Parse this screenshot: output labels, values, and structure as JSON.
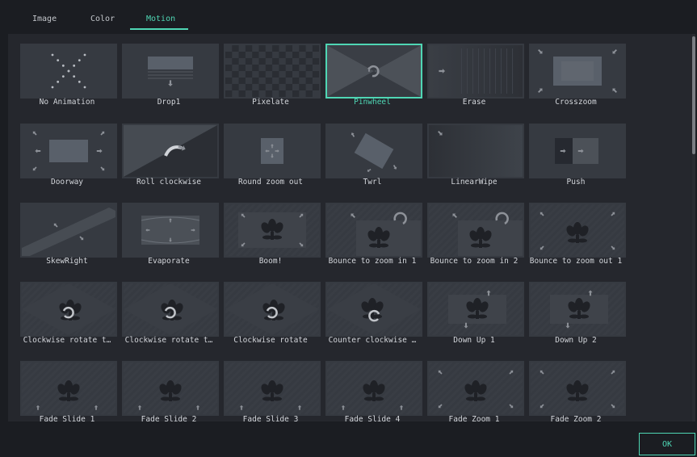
{
  "tabs": [
    {
      "label": "Image"
    },
    {
      "label": "Color"
    },
    {
      "label": "Motion"
    }
  ],
  "active_tab": "Motion",
  "selected_item": "Pinwheel",
  "ok_label": "OK",
  "accent_color": "#4fd6b4",
  "items": [
    {
      "label": "No Animation",
      "icon": "dots-x-icon"
    },
    {
      "label": "Drop1",
      "icon": "drop-icon"
    },
    {
      "label": "Pixelate",
      "icon": "checker-icon"
    },
    {
      "label": "Pinwheel",
      "icon": "pinwheel-icon"
    },
    {
      "label": "Erase",
      "icon": "erase-icon"
    },
    {
      "label": "Crosszoom",
      "icon": "crosszoom-icon"
    },
    {
      "label": "Doorway",
      "icon": "doorway-icon"
    },
    {
      "label": "Roll clockwise",
      "icon": "roll-icon"
    },
    {
      "label": "Round zoom out",
      "icon": "round-zoom-icon"
    },
    {
      "label": "Twrl",
      "icon": "twirl-icon"
    },
    {
      "label": "LinearWipe",
      "icon": "linear-wipe-icon"
    },
    {
      "label": "Push",
      "icon": "push-icon"
    },
    {
      "label": "SkewRight",
      "icon": "skew-icon"
    },
    {
      "label": "Evaporate",
      "icon": "evaporate-icon"
    },
    {
      "label": "Boom!",
      "icon": "boom-icon"
    },
    {
      "label": "Bounce to zoom in 1",
      "icon": "bounce-zoom-in-icon"
    },
    {
      "label": "Bounce to zoom in 2",
      "icon": "bounce-zoom-in-icon"
    },
    {
      "label": "Bounce to zoom out 1",
      "icon": "bounce-zoom-out-icon"
    },
    {
      "label": "Clockwise rotate t…",
      "icon": "rotate-cw-icon"
    },
    {
      "label": "Clockwise rotate t…",
      "icon": "rotate-cw-icon"
    },
    {
      "label": "Clockwise rotate",
      "icon": "rotate-cw-icon"
    },
    {
      "label": "Counter clockwise …",
      "icon": "rotate-ccw-icon"
    },
    {
      "label": "Down Up 1",
      "icon": "down-up-icon"
    },
    {
      "label": "Down Up 2",
      "icon": "down-up-icon"
    },
    {
      "label": "Fade Slide 1",
      "icon": "slide-icon"
    },
    {
      "label": "Fade Slide 2",
      "icon": "slide-icon"
    },
    {
      "label": "Fade Slide 3",
      "icon": "slide-icon"
    },
    {
      "label": "Fade Slide 4",
      "icon": "slide-icon"
    },
    {
      "label": "Fade Zoom 1",
      "icon": "zoom-icon"
    },
    {
      "label": "Fade Zoom 2",
      "icon": "zoom-icon"
    }
  ]
}
